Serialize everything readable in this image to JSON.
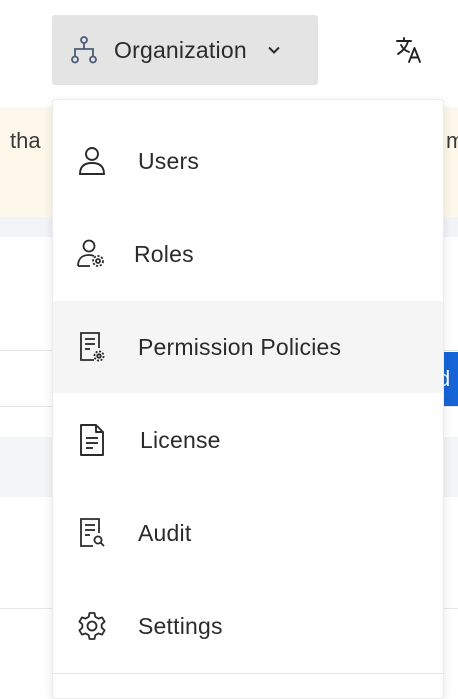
{
  "header": {
    "org_button_label": "Organization",
    "org_icon": "org-tree-icon",
    "chevron_icon": "chevron-down-icon",
    "translate_icon": "translate-icon"
  },
  "background": {
    "banner_left_text": "tha",
    "banner_right_text": "m",
    "blue_button_text": "d"
  },
  "menu": {
    "items": [
      {
        "label": "Users",
        "icon": "user-icon"
      },
      {
        "label": "Roles",
        "icon": "user-gear-icon"
      },
      {
        "label": "Permission Policies",
        "icon": "document-gear-icon",
        "active": true
      },
      {
        "label": "License",
        "icon": "document-icon"
      },
      {
        "label": "Audit",
        "icon": "document-search-icon"
      },
      {
        "label": "Settings",
        "icon": "gear-icon"
      }
    ]
  },
  "colors": {
    "active_item_bg": "#f5f5f5",
    "header_button_bg": "#e4e4e4",
    "banner_bg": "#fdf8ea",
    "accent_blue": "#1565d8"
  }
}
